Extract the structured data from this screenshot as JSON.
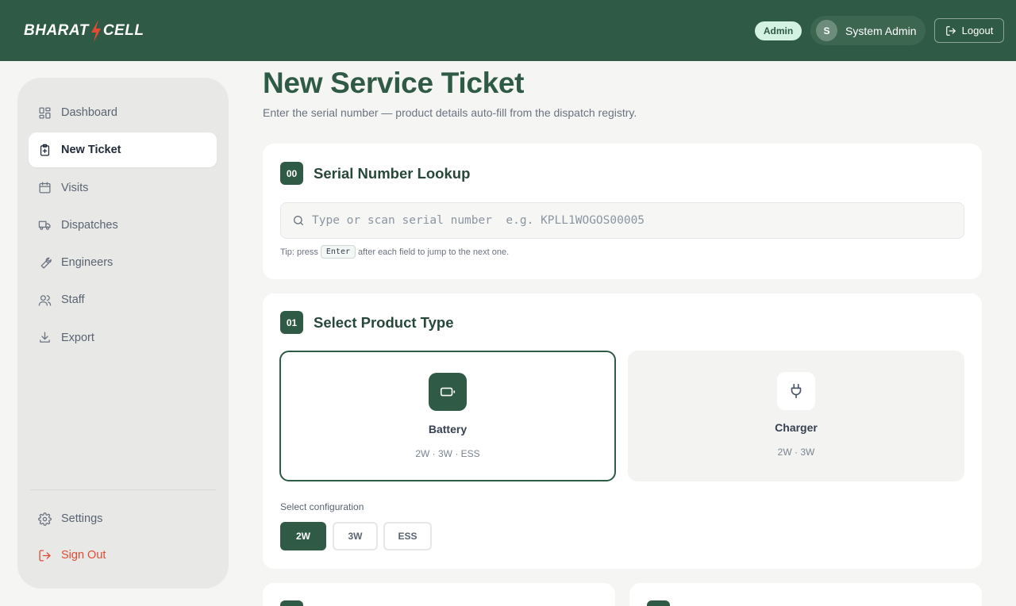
{
  "header": {
    "brand_left": "BHARAT",
    "brand_right": "CELL",
    "role_badge": "Admin",
    "user_initial": "S",
    "user_name": "System Admin",
    "logout_label": "Logout"
  },
  "sidebar": {
    "items": [
      {
        "label": "Dashboard",
        "icon": "dashboard-grid-icon",
        "active": false
      },
      {
        "label": "New Ticket",
        "icon": "clipboard-plus-icon",
        "active": true
      },
      {
        "label": "Visits",
        "icon": "calendar-icon",
        "active": false
      },
      {
        "label": "Dispatches",
        "icon": "truck-icon",
        "active": false
      },
      {
        "label": "Engineers",
        "icon": "wrench-icon",
        "active": false
      },
      {
        "label": "Staff",
        "icon": "users-icon",
        "active": false
      },
      {
        "label": "Export",
        "icon": "download-icon",
        "active": false
      }
    ],
    "bottom": [
      {
        "label": "Settings",
        "icon": "gear-icon"
      },
      {
        "label": "Sign Out",
        "icon": "sign-out-icon"
      }
    ]
  },
  "page": {
    "title": "New Service Ticket",
    "subtitle": "Enter the serial number — product details auto-fill from the dispatch registry."
  },
  "serial_lookup": {
    "step": "00",
    "title": "Serial Number Lookup",
    "placeholder": "Type or scan serial number  e.g. KPLL1WOGOS00005",
    "value": "",
    "tip_before": "Tip: press",
    "tip_key": "Enter",
    "tip_after": "after each field to jump to the next one."
  },
  "product_type": {
    "step": "01",
    "title": "Select Product Type",
    "options": [
      {
        "name": "Battery",
        "sub": "2W · 3W · ESS",
        "icon": "battery-icon",
        "selected": true
      },
      {
        "name": "Charger",
        "sub": "2W · 3W",
        "icon": "plug-icon",
        "selected": false
      }
    ],
    "config_label": "Select configuration",
    "configs": [
      {
        "label": "2W",
        "active": true
      },
      {
        "label": "3W",
        "active": false
      },
      {
        "label": "ESS",
        "active": false
      }
    ]
  },
  "colors": {
    "brand": "#2f5a45",
    "accent_red": "#e24b33",
    "badge_bg": "#d4f2e1"
  }
}
